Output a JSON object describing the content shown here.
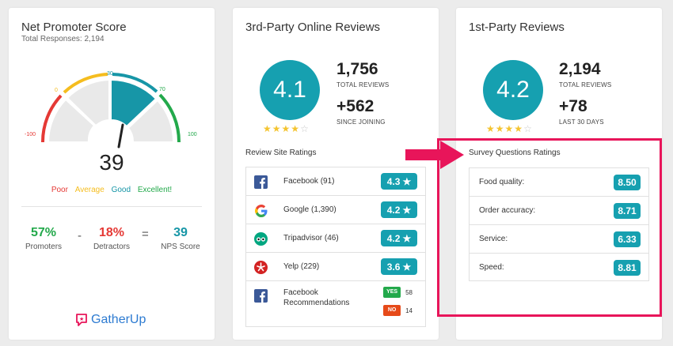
{
  "nps": {
    "title": "Net Promoter Score",
    "subtitle": "Total Responses: 2,194",
    "ticks": {
      "neg100": "-100",
      "zero": "0",
      "thirty": "30",
      "seventy": "70",
      "hundred": "100"
    },
    "score": "39",
    "score_value": 39,
    "legend": {
      "poor": "Poor",
      "average": "Average",
      "good": "Good",
      "excellent": "Excellent!"
    },
    "promoters": {
      "value": "57%",
      "label": "Promoters"
    },
    "minus": "-",
    "detractors": {
      "value": "18%",
      "label": "Detractors"
    },
    "equals": "=",
    "nps_score": {
      "value": "39",
      "label": "NPS Score"
    },
    "logo_text": "GatherUp",
    "colors": {
      "red": "#e53935",
      "yellow": "#f5bd1f",
      "teal": "#1796a7",
      "green": "#23a94b",
      "gray": "#e9e9e9"
    }
  },
  "third_party": {
    "title": "3rd-Party Online Reviews",
    "rating": "4.1",
    "stars_filled": 4,
    "stars_total": 5,
    "total_reviews": "1,756",
    "total_reviews_label": "TOTAL REVIEWS",
    "since": "+562",
    "since_label": "SINCE JOINING",
    "section_title": "Review Site Ratings",
    "sites": [
      {
        "icon": "facebook-icon",
        "name": "Facebook (91)",
        "rating": "4.3"
      },
      {
        "icon": "google-icon",
        "name": "Google (1,390)",
        "rating": "4.2"
      },
      {
        "icon": "tripadvisor-icon",
        "name": "Tripadvisor (46)",
        "rating": "4.2"
      },
      {
        "icon": "yelp-icon",
        "name": "Yelp (229)",
        "rating": "3.6"
      }
    ],
    "recommendations": {
      "icon": "facebook-icon",
      "name_line1": "Facebook",
      "name_line2": "Recommendations",
      "yes_label": "YES",
      "yes_count": "58",
      "no_label": "NO",
      "no_count": "14"
    }
  },
  "first_party": {
    "title": "1st-Party Reviews",
    "rating": "4.2",
    "stars_filled": 4,
    "stars_total": 5,
    "total_reviews": "2,194",
    "total_reviews_label": "TOTAL REVIEWS",
    "last30": "+78",
    "last30_label": "LAST 30 DAYS",
    "section_title": "Survey Questions Ratings",
    "questions": [
      {
        "label": "Food quality:",
        "value": "8.50"
      },
      {
        "label": "Order accuracy:",
        "value": "8.71"
      },
      {
        "label": "Service:",
        "value": "6.33"
      },
      {
        "label": "Speed:",
        "value": "8.81"
      }
    ]
  }
}
